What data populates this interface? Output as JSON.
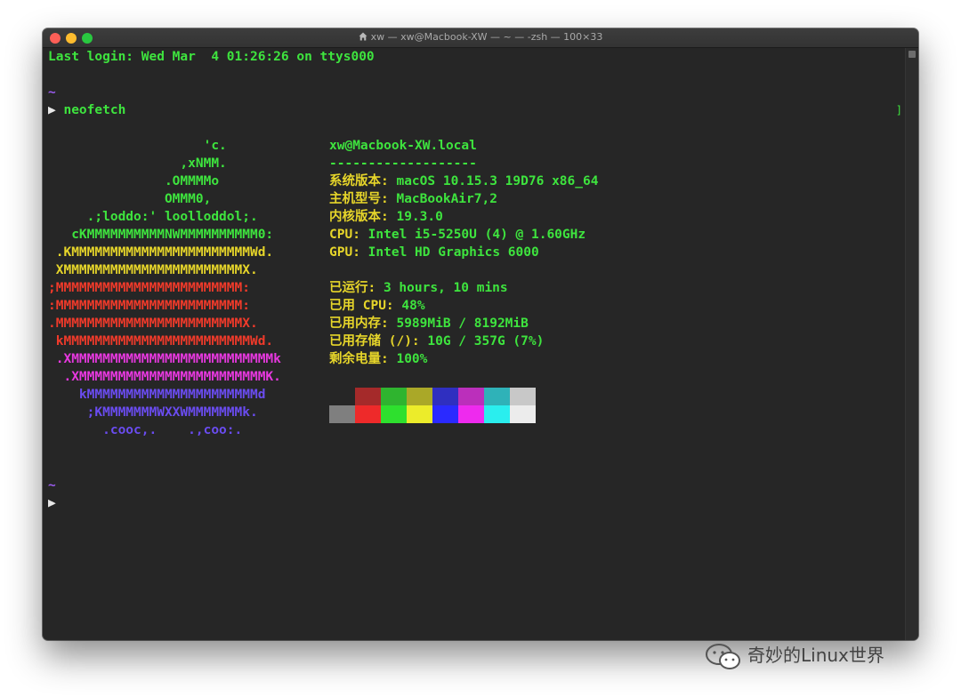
{
  "window": {
    "title": "xw — xw@Macbook-XW — ~ — -zsh — 100×33"
  },
  "terminal": {
    "last_login": "Last login: Wed Mar  4 01:26:26 on ttys000",
    "tilde": "~",
    "command": "neofetch",
    "prompt_symbol": "▶",
    "trailing_bracket": "]"
  },
  "neofetch": {
    "logo_lines": [
      {
        "text": "                    'c.",
        "color": "#3ee43e"
      },
      {
        "text": "                 ,xNMM.",
        "color": "#3ee43e"
      },
      {
        "text": "               .OMMMMo",
        "color": "#3ee43e"
      },
      {
        "text": "               OMMM0,",
        "color": "#3ee43e"
      },
      {
        "text": "     .;loddo:' loolloddol;.",
        "color": "#3ee43e"
      },
      {
        "text": "   cKMMMMMMMMMMNWMMMMMMMMMM0:",
        "color": "#3ee43e"
      },
      {
        "text": " .KMMMMMMMMMMMMMMMMMMMMMMMWd.",
        "color": "#e6d52a"
      },
      {
        "text": " XMMMMMMMMMMMMMMMMMMMMMMMX.",
        "color": "#e6d52a"
      },
      {
        "text": ";MMMMMMMMMMMMMMMMMMMMMMMM:",
        "color": "#f03a2a"
      },
      {
        "text": ":MMMMMMMMMMMMMMMMMMMMMMMM:",
        "color": "#f03a2a"
      },
      {
        "text": ".MMMMMMMMMMMMMMMMMMMMMMMMX.",
        "color": "#f03a2a"
      },
      {
        "text": " kMMMMMMMMMMMMMMMMMMMMMMMMWd.",
        "color": "#f03a2a"
      },
      {
        "text": " .XMMMMMMMMMMMMMMMMMMMMMMMMMMk",
        "color": "#e838e0"
      },
      {
        "text": "  .XMMMMMMMMMMMMMMMMMMMMMMMMK.",
        "color": "#e838e0"
      },
      {
        "text": "    kMMMMMMMMMMMMMMMMMMMMMMd",
        "color": "#6a4cf0"
      },
      {
        "text": "     ;KMMMMMMMWXXWMMMMMMMk.",
        "color": "#6a4cf0"
      },
      {
        "text": "       .cooc,.    .,coo:.",
        "color": "#6a4cf0"
      }
    ],
    "host": "xw@Macbook-XW.local",
    "separator": "-------------------",
    "info": [
      {
        "key": "系统版本",
        "sep": ": ",
        "value": "macOS 10.15.3 19D76 x86_64"
      },
      {
        "key": "主机型号",
        "sep": ": ",
        "value": "MacBookAir7,2"
      },
      {
        "key": "内核版本",
        "sep": ": ",
        "value": "19.3.0"
      },
      {
        "key": "CPU",
        "sep": ": ",
        "value": "Intel i5-5250U (4) @ 1.60GHz"
      },
      {
        "key": "GPU",
        "sep": ": ",
        "value": "Intel HD Graphics 6000"
      },
      {
        "key": "",
        "sep": "",
        "value": ""
      },
      {
        "key": "已运行",
        "sep": ": ",
        "value": "3 hours, 10 mins"
      },
      {
        "key": "已用 CPU",
        "sep": ": ",
        "value": "48%"
      },
      {
        "key": "已用内存",
        "sep": ": ",
        "value": "5989MiB / 8192MiB"
      },
      {
        "key": "已用存储 (/)",
        "sep": ": ",
        "value": "10G / 357G (7%)"
      },
      {
        "key": "剩余电量",
        "sep": ": ",
        "value": "100%"
      }
    ],
    "palette_top": [
      "#262626",
      "#a52a2a",
      "#2fb42f",
      "#aaa828",
      "#2f2fc0",
      "#bb2fbb",
      "#2fb2b8",
      "#c8c8c8"
    ],
    "palette_bottom": [
      "#7f7f7f",
      "#ee2a2a",
      "#2ee02e",
      "#ecec2a",
      "#2a2aff",
      "#ee2aee",
      "#2aeeee",
      "#ececec"
    ]
  },
  "watermark": {
    "text": "奇妙的Linux世界"
  }
}
